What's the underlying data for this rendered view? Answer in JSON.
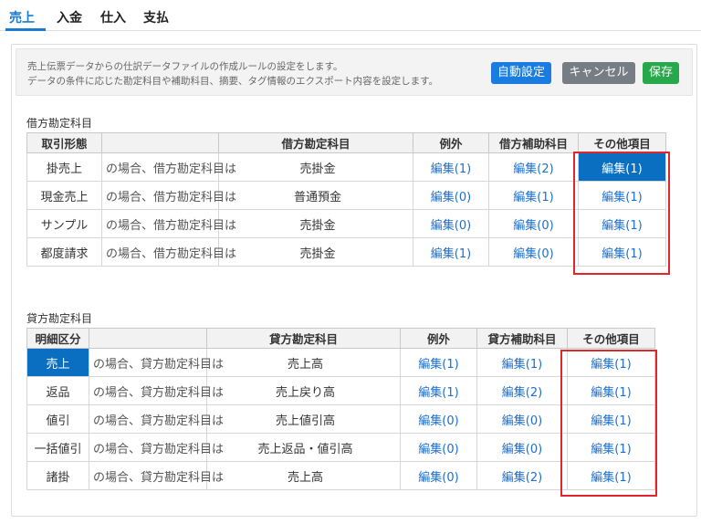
{
  "tabs": [
    {
      "label": "売上",
      "active": true
    },
    {
      "label": "入金",
      "active": false
    },
    {
      "label": "仕入",
      "active": false
    },
    {
      "label": "支払",
      "active": false
    }
  ],
  "description": {
    "line1": "売上伝票データからの仕訳データファイルの作成ルールの設定をします。",
    "line2": "データの条件に応じた勘定科目や補助科目、摘要、タグ情報のエクスポート内容を設定します。"
  },
  "buttons": {
    "auto": "自動設定",
    "cancel": "キャンセル",
    "save": "保存"
  },
  "debit": {
    "section_title": "借方勘定科目",
    "headers": [
      "取引形態",
      "",
      "借方勘定科目",
      "例外",
      "借方補助科目",
      "その他項目"
    ],
    "rows": [
      {
        "type": "掛売上",
        "cond": "の場合、借方勘定科目は",
        "account": "売掛金",
        "exception": "編集(1)",
        "sub": "編集(2)",
        "other": "編集(1)"
      },
      {
        "type": "現金売上",
        "cond": "の場合、借方勘定科目は",
        "account": "普通預金",
        "exception": "編集(0)",
        "sub": "編集(1)",
        "other": "編集(1)"
      },
      {
        "type": "サンプル",
        "cond": "の場合、借方勘定科目は",
        "account": "売掛金",
        "exception": "編集(0)",
        "sub": "編集(0)",
        "other": "編集(1)"
      },
      {
        "type": "都度請求",
        "cond": "の場合、借方勘定科目は",
        "account": "売掛金",
        "exception": "編集(1)",
        "sub": "編集(0)",
        "other": "編集(1)"
      }
    ]
  },
  "credit": {
    "section_title": "貸方勘定科目",
    "headers": [
      "明細区分",
      "",
      "貸方勘定科目",
      "例外",
      "貸方補助科目",
      "その他項目"
    ],
    "rows": [
      {
        "type": "売上",
        "cond": "の場合、貸方勘定科目は",
        "account": "売上高",
        "exception": "編集(1)",
        "sub": "編集(1)",
        "other": "編集(1)"
      },
      {
        "type": "返品",
        "cond": "の場合、貸方勘定科目は",
        "account": "売上戻り高",
        "exception": "編集(1)",
        "sub": "編集(2)",
        "other": "編集(1)"
      },
      {
        "type": "値引",
        "cond": "の場合、貸方勘定科目は",
        "account": "売上値引高",
        "exception": "編集(0)",
        "sub": "編集(0)",
        "other": "編集(1)"
      },
      {
        "type": "一括値引",
        "cond": "の場合、貸方勘定科目は",
        "account": "売上返品・値引高",
        "exception": "編集(0)",
        "sub": "編集(0)",
        "other": "編集(1)"
      },
      {
        "type": "諸掛",
        "cond": "の場合、貸方勘定科目は",
        "account": "売上高",
        "exception": "編集(0)",
        "sub": "編集(2)",
        "other": "編集(1)"
      }
    ]
  },
  "colors": {
    "accent": "#1a7cd0",
    "selected_cell": "#0a6fc0",
    "save": "#27a84a",
    "cancel": "#777d85",
    "highlight_box": "#e0262b"
  }
}
